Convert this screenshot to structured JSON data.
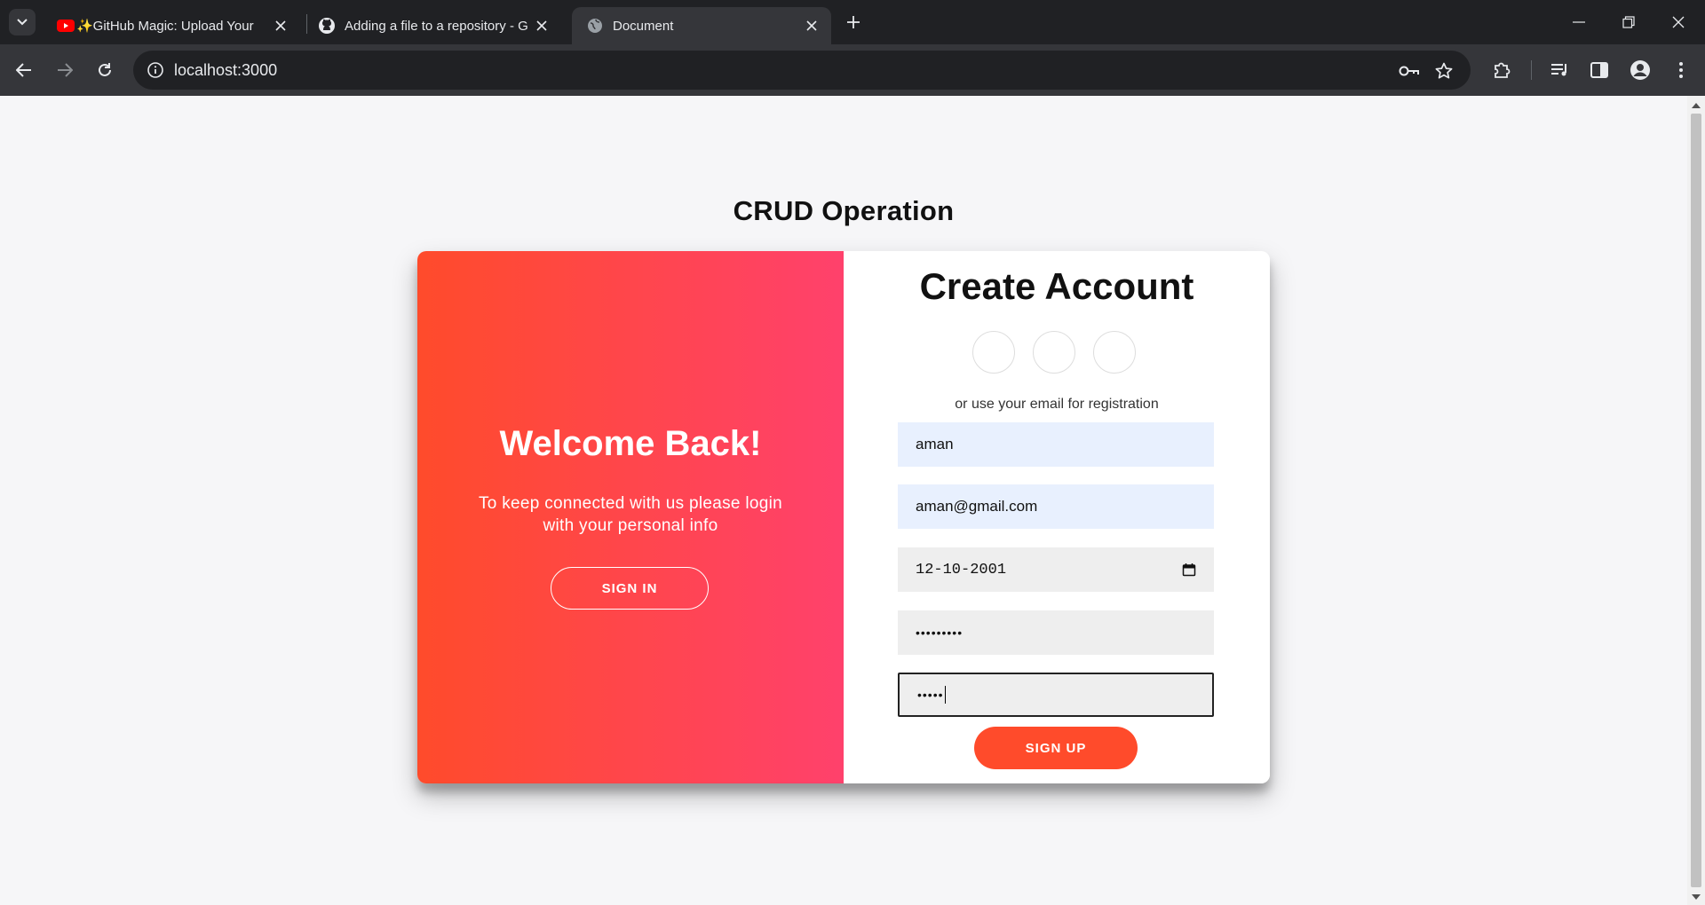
{
  "browser": {
    "tabs": [
      {
        "title": "✨GitHub Magic: Upload Your",
        "icon": "youtube-icon",
        "active": false
      },
      {
        "title": "Adding a file to a repository - G",
        "icon": "github-icon",
        "active": false
      },
      {
        "title": "Document",
        "icon": "globe-icon",
        "active": true
      }
    ],
    "url": "localhost:3000"
  },
  "page": {
    "title": "CRUD Operation"
  },
  "overlay": {
    "heading": "Welcome Back!",
    "text": "To keep connected with us please login with your personal info",
    "button": "SIGN IN"
  },
  "form": {
    "heading": "Create Account",
    "registration_text": "or use your email for registration",
    "name_value": "aman",
    "email_value": "aman@gmail.com",
    "date_value": "12-10-2001",
    "password_value": "•••••••••",
    "confirm_value": "•••••",
    "button": "SIGN UP"
  },
  "colors": {
    "gradient_start": "#ff4b2b",
    "gradient_end": "#ff416c",
    "button": "#ff4b2b"
  }
}
